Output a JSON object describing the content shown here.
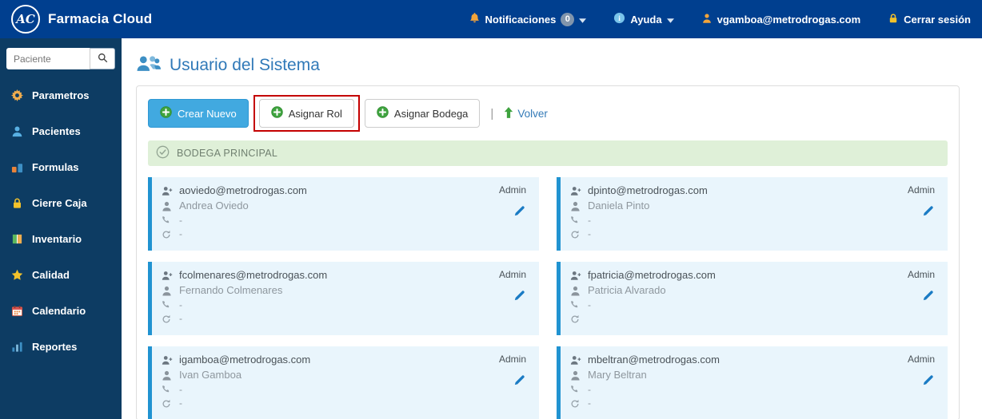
{
  "topbar": {
    "logo_text": "AC",
    "brand": "Farmacia Cloud",
    "notifications_label": "Notificaciones",
    "notifications_count": "0",
    "help_label": "Ayuda",
    "user_email": "vgamboa@metrodrogas.com",
    "logout_label": "Cerrar sesión"
  },
  "sidebar": {
    "search_placeholder": "Paciente",
    "items": [
      {
        "label": "Parametros",
        "icon": "gear"
      },
      {
        "label": "Pacientes",
        "icon": "person"
      },
      {
        "label": "Formulas",
        "icon": "formula"
      },
      {
        "label": "Cierre Caja",
        "icon": "lock"
      },
      {
        "label": "Inventario",
        "icon": "inventory"
      },
      {
        "label": "Calidad",
        "icon": "star"
      },
      {
        "label": "Calendario",
        "icon": "calendar"
      },
      {
        "label": "Reportes",
        "icon": "report"
      }
    ]
  },
  "main": {
    "title": "Usuario del Sistema",
    "toolbar": {
      "create_new": "Crear Nuevo",
      "assign_role": "Asignar Rol",
      "assign_warehouse": "Asignar Bodega",
      "divider": "|",
      "back": "Volver"
    },
    "section_header": "BODEGA PRINCIPAL",
    "users": [
      {
        "email": "aoviedo@metrodrogas.com",
        "name": "Andrea Oviedo",
        "phone": "-",
        "sync": "-",
        "role": "Admin"
      },
      {
        "email": "dpinto@metrodrogas.com",
        "name": "Daniela Pinto",
        "phone": "-",
        "sync": "-",
        "role": "Admin"
      },
      {
        "email": "fcolmenares@metrodrogas.com",
        "name": "Fernando Colmenares",
        "phone": "-",
        "sync": "-",
        "role": "Admin"
      },
      {
        "email": "fpatricia@metrodrogas.com",
        "name": "Patricia Alvarado",
        "phone": "-",
        "sync": "",
        "role": "Admin"
      },
      {
        "email": "igamboa@metrodrogas.com",
        "name": "Ivan Gamboa",
        "phone": "-",
        "sync": "-",
        "role": "Admin"
      },
      {
        "email": "mbeltran@metrodrogas.com",
        "name": "Mary Beltran",
        "phone": "-",
        "sync": "-",
        "role": "Admin"
      }
    ]
  },
  "colors": {
    "topbar_bg": "#003f8f",
    "sidebar_bg": "#0d3c63",
    "accent_blue": "#3079b8",
    "button_blue": "#41a9e0",
    "highlight_red": "#c40000",
    "success_bg": "#dff0d8",
    "success_text": "#708070",
    "card_bg": "#e9f5fc",
    "card_border": "#2193d1",
    "icon_green": "#3fa33f",
    "icon_orange": "#f2a43a",
    "icon_yellow": "#f3c22b",
    "pencil_blue": "#1a7bc4"
  }
}
